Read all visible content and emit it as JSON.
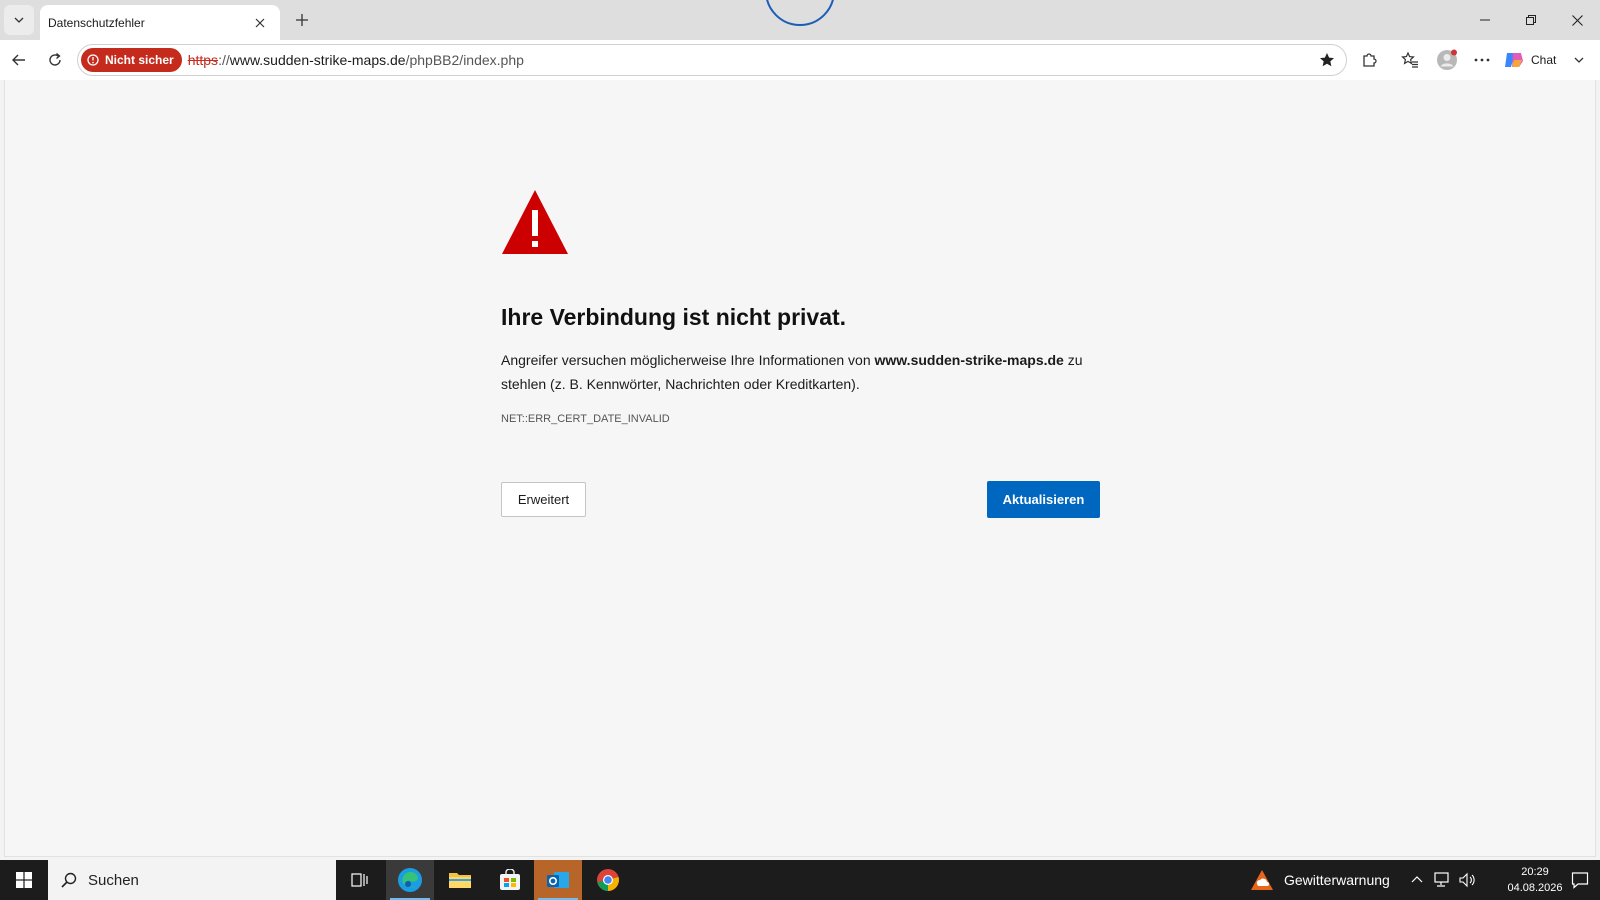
{
  "tab": {
    "title": "Datenschutzfehler"
  },
  "address": {
    "security_label": "Nicht sicher",
    "scheme": "https",
    "separator": "://",
    "host": "www.sudden-strike-maps.de",
    "path": "/phpBB2/index.php"
  },
  "toolbar": {
    "chat_label": "Chat"
  },
  "error": {
    "heading": "Ihre Verbindung ist nicht privat.",
    "desc_prefix": "Angreifer versuchen möglicherweise Ihre Informationen von ",
    "desc_host": "www.sudden-strike-maps.de",
    "desc_suffix": " zu stehlen (z. B. Kennwörter, Nachrichten oder Kreditkarten).",
    "code": "NET::ERR_CERT_DATE_INVALID",
    "advanced_label": "Erweitert",
    "reload_label": "Aktualisieren"
  },
  "taskbar": {
    "search_label": "Suchen",
    "weather_label": "Gewitterwarnung",
    "time": "20:29",
    "date": "04.08.2026"
  },
  "colors": {
    "warning_red": "#c42b1c",
    "accent_blue": "#0067c0",
    "taskbar_bg": "#1c1c1c"
  }
}
